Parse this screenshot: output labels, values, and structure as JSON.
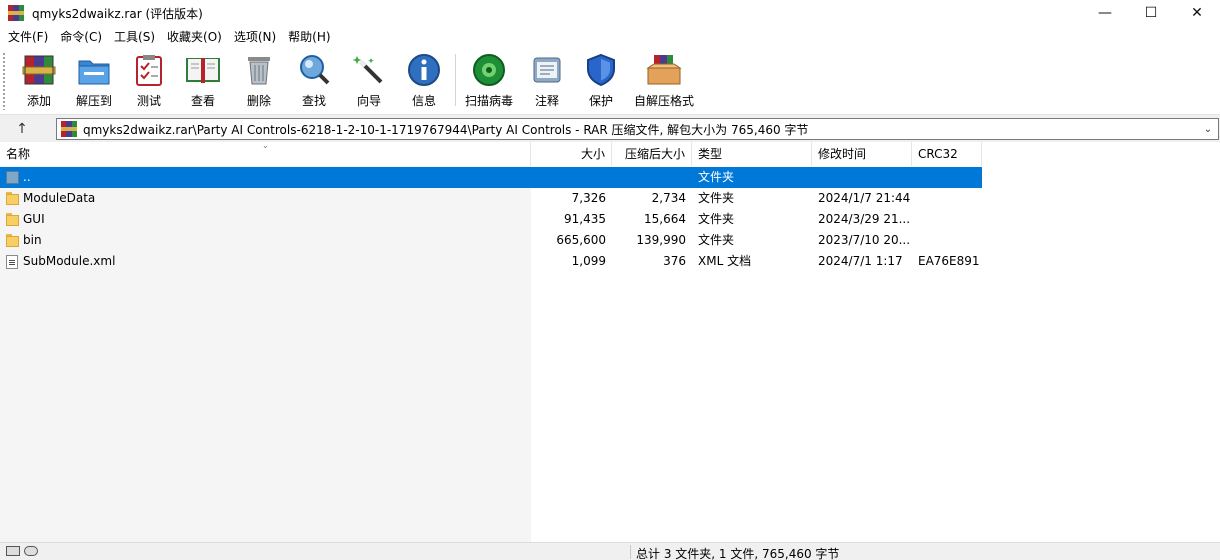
{
  "window": {
    "title": "qmyks2dwaikz.rar (评估版本)",
    "minimize": "—",
    "maximize": "☐",
    "close": "✕"
  },
  "menu": [
    "文件(F)",
    "命令(C)",
    "工具(S)",
    "收藏夹(O)",
    "选项(N)",
    "帮助(H)"
  ],
  "toolbar": {
    "add": "添加",
    "extract_to": "解压到",
    "test": "测试",
    "view": "查看",
    "delete": "删除",
    "find": "查找",
    "wizard": "向导",
    "info": "信息",
    "virus_scan": "扫描病毒",
    "comment": "注释",
    "protect": "保护",
    "sfx": "自解压格式"
  },
  "address": {
    "up": "↑",
    "path": "qmyks2dwaikz.rar\\Party AI Controls-6218-1-2-10-1-1719767944\\Party AI Controls - RAR 压缩文件, 解包大小为 765,460 字节",
    "dropdown": "⌄"
  },
  "columns": {
    "name": "名称",
    "size": "大小",
    "packed": "压缩后大小",
    "type": "类型",
    "modified": "修改时间",
    "crc": "CRC32"
  },
  "rows": [
    {
      "name": "..",
      "size": "",
      "packed": "",
      "type": "文件夹",
      "modified": "",
      "crc": "",
      "kind": "up",
      "selected": true
    },
    {
      "name": "ModuleData",
      "size": "7,326",
      "packed": "2,734",
      "type": "文件夹",
      "modified": "2024/1/7 21:44",
      "crc": "",
      "kind": "folder"
    },
    {
      "name": "GUI",
      "size": "91,435",
      "packed": "15,664",
      "type": "文件夹",
      "modified": "2024/3/29 21...",
      "crc": "",
      "kind": "folder"
    },
    {
      "name": "bin",
      "size": "665,600",
      "packed": "139,990",
      "type": "文件夹",
      "modified": "2023/7/10 20...",
      "crc": "",
      "kind": "folder"
    },
    {
      "name": "SubModule.xml",
      "size": "1,099",
      "packed": "376",
      "type": "XML 文档",
      "modified": "2024/7/1 1:17",
      "crc": "EA76E891",
      "kind": "file"
    }
  ],
  "status": {
    "summary": "总计 3 文件夹, 1 文件, 765,460 字节"
  },
  "colors": {
    "selection": "#0078d7"
  }
}
